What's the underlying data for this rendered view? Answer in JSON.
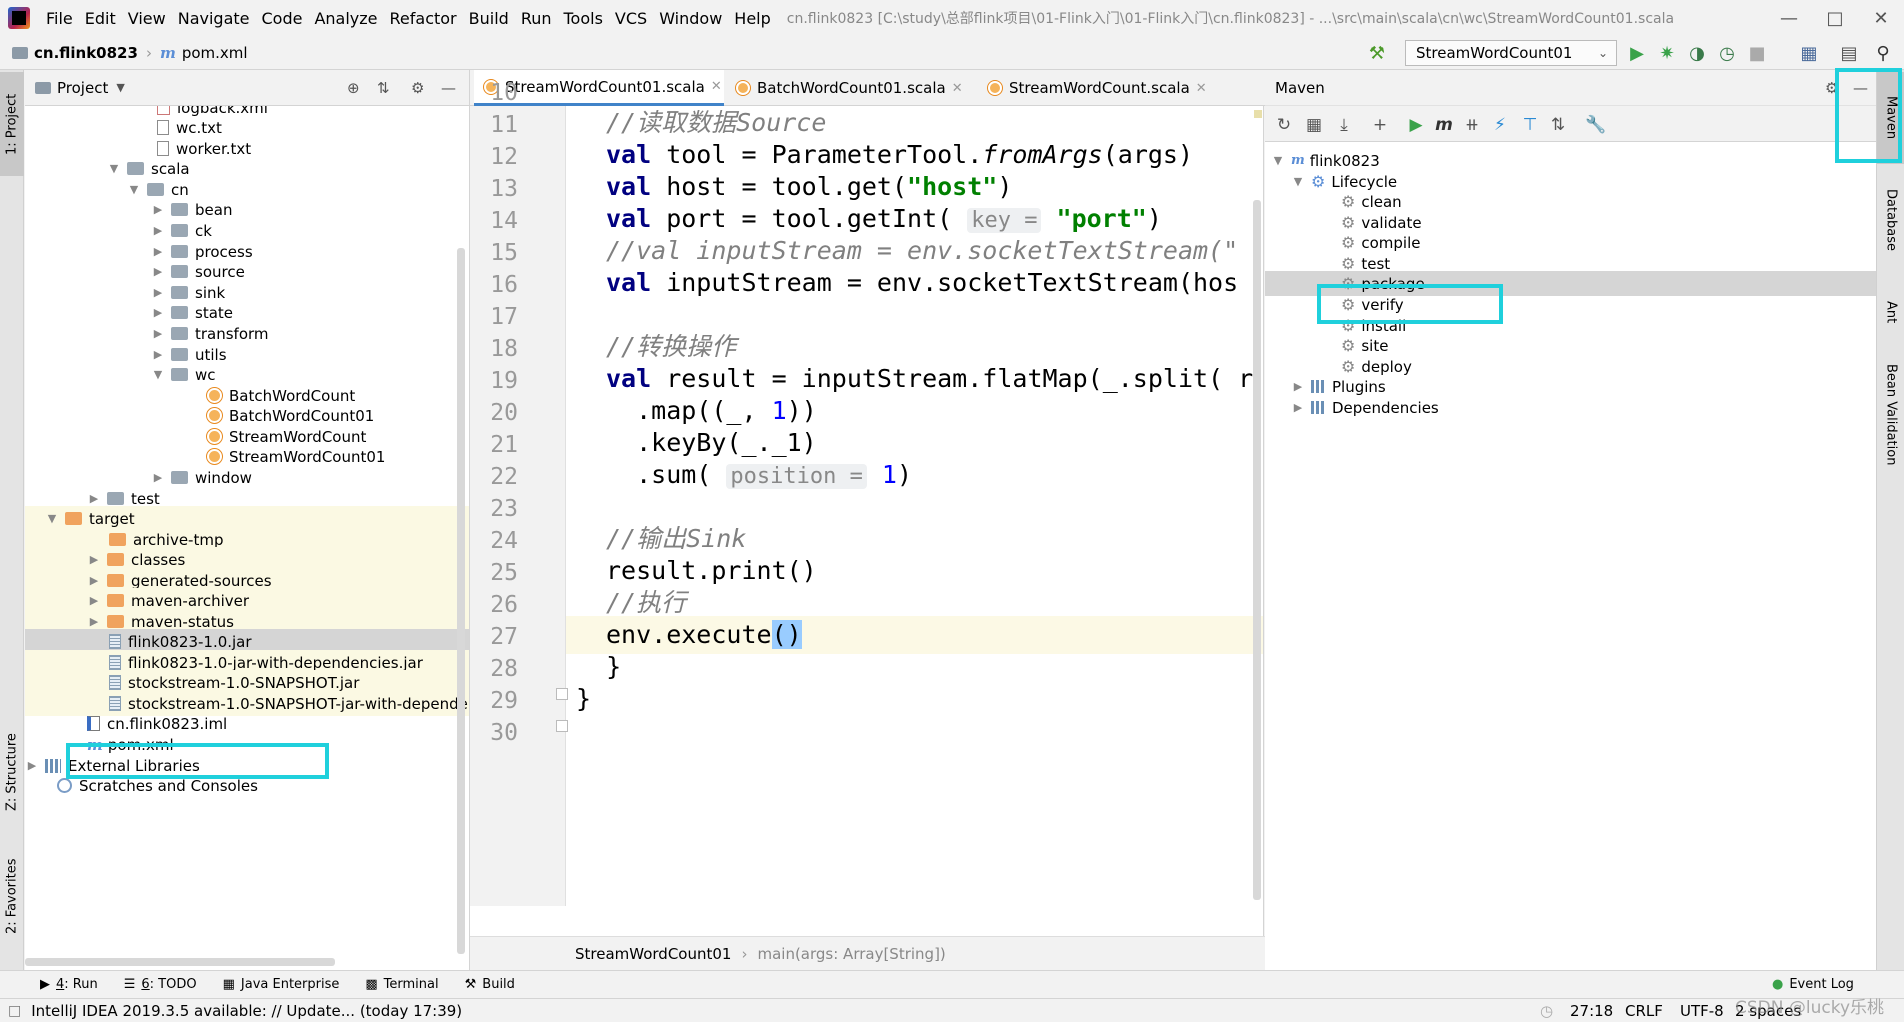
{
  "menubar": {
    "items": [
      "File",
      "Edit",
      "View",
      "Navigate",
      "Code",
      "Analyze",
      "Refactor",
      "Build",
      "Run",
      "Tools",
      "VCS",
      "Window",
      "Help"
    ],
    "title": "cn.flink0823 [C:\\study\\总部flink项目\\01-Flink入门\\01-Flink入门\\cn.flink0823] - ...\\src\\main\\scala\\cn\\wc\\StreamWordCount01.scala"
  },
  "navbar": {
    "project": "cn.flink0823",
    "file": "pom.xml",
    "run_config": "StreamWordCount01"
  },
  "left_strip": {
    "project_tab": "1: Project",
    "structure_tab": "Z: Structure",
    "favorites_tab": "2: Favorites"
  },
  "project_panel": {
    "title": "Project",
    "rows": [
      {
        "label": "logback.xml"
      },
      {
        "label": "wc.txt"
      },
      {
        "label": "worker.txt"
      },
      {
        "label": "scala"
      },
      {
        "label": "cn"
      },
      {
        "label": "bean"
      },
      {
        "label": "ck"
      },
      {
        "label": "process"
      },
      {
        "label": "source"
      },
      {
        "label": "sink"
      },
      {
        "label": "state"
      },
      {
        "label": "transform"
      },
      {
        "label": "utils"
      },
      {
        "label": "wc"
      },
      {
        "label": "BatchWordCount"
      },
      {
        "label": "BatchWordCount01"
      },
      {
        "label": "StreamWordCount"
      },
      {
        "label": "StreamWordCount01"
      },
      {
        "label": "window"
      },
      {
        "label": "test"
      },
      {
        "label": "target"
      },
      {
        "label": "archive-tmp"
      },
      {
        "label": "classes"
      },
      {
        "label": "generated-sources"
      },
      {
        "label": "maven-archiver"
      },
      {
        "label": "maven-status"
      },
      {
        "label": "flink0823-1.0.jar"
      },
      {
        "label": "flink0823-1.0-jar-with-dependencies.jar"
      },
      {
        "label": "stockstream-1.0-SNAPSHOT.jar"
      },
      {
        "label": "stockstream-1.0-SNAPSHOT-jar-with-dependencies.jar"
      },
      {
        "label": "cn.flink0823.iml"
      },
      {
        "label": "pom.xml"
      },
      {
        "label": "External Libraries"
      },
      {
        "label": "Scratches and Consoles"
      }
    ]
  },
  "editor": {
    "tabs": [
      "StreamWordCount01.scala",
      "BatchWordCount01.scala",
      "StreamWordCount.scala"
    ],
    "line_numbers": [
      "10",
      "11",
      "12",
      "13",
      "14",
      "15",
      "16",
      "17",
      "18",
      "19",
      "20",
      "21",
      "22",
      "23",
      "24",
      "25",
      "26",
      "27",
      "28",
      "29",
      "30"
    ],
    "code": {
      "l11": "//读取数据Source",
      "l12_kw": "val",
      "l12_a": " tool = ParameterTool.",
      "l12_fn": "fromArgs",
      "l12_b": "(args)",
      "l13_kw": "val",
      "l13_a": " host = tool.get(",
      "l13_str": "\"host\"",
      "l13_b": ")",
      "l14_kw": "val",
      "l14_a": " port = tool.getInt( ",
      "l14_hint": "key =",
      "l14_str": " \"port\"",
      "l14_b": ")",
      "l15": "//val inputStream = env.socketTextStream(\"",
      "l16_kw": "val",
      "l16_a": " inputStream = env.socketTextStream(hos",
      "l18": "//转换操作",
      "l19_kw": "val",
      "l19_a": " result = inputStream.flatMap(_.split( r",
      "l20_a": "  .map((_, ",
      "l20_num": "1",
      "l20_b": "))",
      "l21": "  .keyBy(_._1)",
      "l22_a": "  .sum( ",
      "l22_hint": "position =",
      "l22_num": " 1",
      "l22_b": ")",
      "l24": "//输出Sink",
      "l25": "result.print()",
      "l26": "//执行",
      "l27_a": "env.execute",
      "l27_br": "()",
      "l28": "  }",
      "l29": "}"
    },
    "breadcrumb_object": "StreamWordCount01",
    "breadcrumb_method": "main(args: Array[String])"
  },
  "maven": {
    "title": "Maven",
    "root": "flink0823",
    "lifecycle": "Lifecycle",
    "phases": [
      "clean",
      "validate",
      "compile",
      "test",
      "package",
      "verify",
      "install",
      "site",
      "deploy"
    ],
    "plugins": "Plugins",
    "dependencies": "Dependencies"
  },
  "right_strip": {
    "maven_tab": "Maven",
    "database_tab": "Database",
    "ant_tab": "Ant",
    "bean_tab": "Bean Validation"
  },
  "bottom_tools": [
    {
      "key": "4",
      "label": ": Run"
    },
    {
      "key": "6",
      "label": ": TODO"
    },
    {
      "key": "",
      "label": "Java Enterprise"
    },
    {
      "key": "",
      "label": "Terminal"
    },
    {
      "key": "",
      "label": "Build"
    }
  ],
  "event_log": "Event Log",
  "status": {
    "message": "IntelliJ IDEA 2019.3.5 available: // Update... (today 17:39)",
    "position": "27:18",
    "line_sep": "CRLF",
    "encoding": "UTF-8",
    "indent": "2 spaces",
    "watermark": "CSDN @lucky乐桃"
  },
  "colors": {
    "highlight_box": "#1fd0dc",
    "keyword": "#000080",
    "string": "#008000",
    "number": "#0000ff",
    "comment": "#808080"
  }
}
